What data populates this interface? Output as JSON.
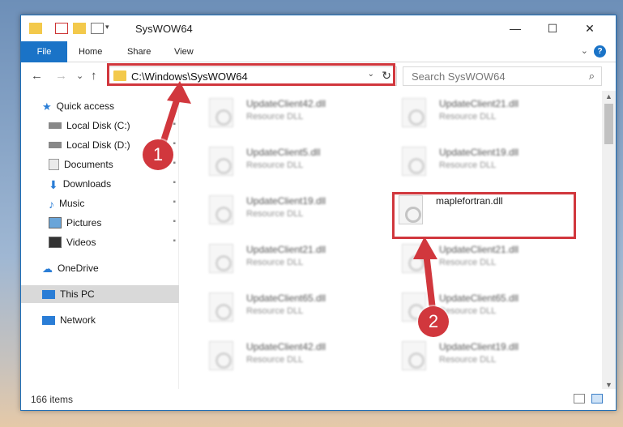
{
  "window": {
    "title": "SysWOW64",
    "minimize_glyph": "—",
    "maximize_glyph": "☐",
    "close_glyph": "✕"
  },
  "ribbon": {
    "tabs": [
      "File",
      "Home",
      "Share",
      "View"
    ],
    "help_glyph": "?"
  },
  "nav": {
    "back_glyph": "←",
    "forward_glyph": "→",
    "recent_glyph": "⌄",
    "up_glyph": "↑",
    "address": "C:\\Windows\\SysWOW64",
    "address_drop_glyph": "⌄",
    "refresh_glyph": "↻",
    "search_placeholder": "Search SysWOW64",
    "search_glyph": "⌕"
  },
  "sidebar": {
    "items": [
      {
        "label": "Quick access",
        "icon": "star-icon"
      },
      {
        "label": "Local Disk (C:)",
        "icon": "drive-icon"
      },
      {
        "label": "Local Disk (D:)",
        "icon": "drive-icon"
      },
      {
        "label": "Documents",
        "icon": "documents-icon"
      },
      {
        "label": "Downloads",
        "icon": "download-icon"
      },
      {
        "label": "Music",
        "icon": "music-icon"
      },
      {
        "label": "Pictures",
        "icon": "pictures-icon"
      },
      {
        "label": "Videos",
        "icon": "videos-icon"
      },
      {
        "label": "OneDrive",
        "icon": "cloud-icon"
      },
      {
        "label": "This PC",
        "icon": "computer-icon"
      },
      {
        "label": "Network",
        "icon": "network-icon"
      }
    ],
    "pin_glyph": "📌"
  },
  "files": {
    "left": [
      {
        "name": "UpdateClient42.dll",
        "type": "Resource DLL"
      },
      {
        "name": "UpdateClient5.dll",
        "type": "Resource DLL"
      },
      {
        "name": "UpdateClient19.dll",
        "type": "Resource DLL"
      },
      {
        "name": "UpdateClient21.dll",
        "type": "Resource DLL"
      },
      {
        "name": "UpdateClient65.dll",
        "type": "Resource DLL"
      },
      {
        "name": "UpdateClient42.dll",
        "type": "Resource DLL"
      }
    ],
    "right": [
      {
        "name": "UpdateClient21.dll",
        "type": "Resource DLL"
      },
      {
        "name": "UpdateClient19.dll",
        "type": "Resource DLL"
      },
      {
        "name": "maplefortran.dll",
        "type": ""
      },
      {
        "name": "UpdateClient21.dll",
        "type": "Resource DLL"
      },
      {
        "name": "UpdateClient65.dll",
        "type": "Resource DLL"
      },
      {
        "name": "UpdateClient19.dll",
        "type": "Resource DLL"
      }
    ]
  },
  "status": {
    "item_count": "166 items"
  },
  "annotations": {
    "step1": "1",
    "step2": "2",
    "color": "#d1373d"
  }
}
